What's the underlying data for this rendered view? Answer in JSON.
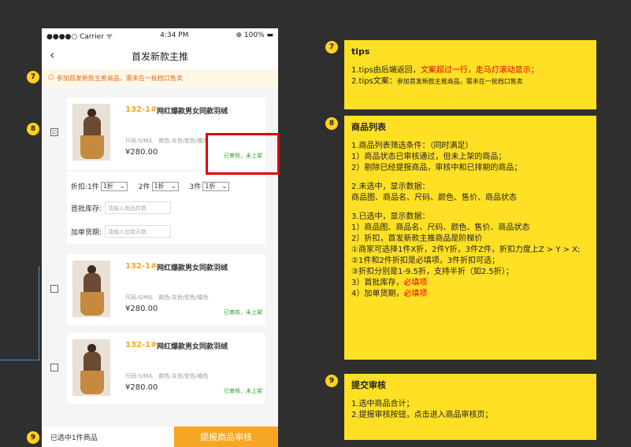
{
  "statusbar": {
    "carrier": "●●●●○ Carrier ᯤ",
    "time": "4:34 PM",
    "battery": "⊕ 100% ▬"
  },
  "nav": {
    "title": "首发新款主推",
    "back_icon": "chevron-left-icon"
  },
  "tips_bar": {
    "text": "参加首发新款主推商品，需未在一批档口售卖"
  },
  "products": [
    {
      "code": "132-1#",
      "name": "网红爆款男女同款羽绒",
      "attrs": "尺码:S/M/L　颜色:灰色/驼色/橘色",
      "price": "¥280.00",
      "state": "已审核，未上架",
      "checked": "☑"
    },
    {
      "code": "132-1#",
      "name": "网红爆款男女同款羽绒",
      "attrs": "尺码:S/M/L　颜色:灰色/驼色/橘色",
      "price": "¥280.00",
      "state": "已审核，未上架",
      "checked": ""
    },
    {
      "code": "132-1#",
      "name": "网红爆款男女同款羽绒",
      "attrs": "尺码:S/M/L　颜色:灰色/驼色/橘色",
      "price": "¥280.00",
      "state": "已审核，未上架",
      "checked": ""
    }
  ],
  "options": {
    "discount_label": "折扣:",
    "tier1": "1件",
    "tier2": "2件",
    "tier3": "3件",
    "select_value": "1折",
    "stock_label": "首批库存:",
    "stock_placeholder": "请输入商品件数",
    "days_label": "加单货期:",
    "days_placeholder": "请输入加单天数"
  },
  "footer": {
    "summary": "已选中1件商品",
    "submit": "提报商品审核"
  },
  "badges": {
    "b7": "7",
    "b8": "8",
    "b9": "9"
  },
  "notes": {
    "tips": {
      "badge": "7",
      "title": "tips",
      "l1a": "1.tips由后端返回，",
      "l1b": "文案超过一行，走马灯滚动显示；",
      "l2a": "2.tips文案：",
      "l2b": "参加首发新款主推商品，需未在一批档口售卖"
    },
    "list": {
      "badge": "8",
      "title": "商品列表",
      "l1": "1.商品列表筛选条件：（同时满足）",
      "l2": "1）商品状态已审核通过，但未上架的商品；",
      "l3": "2）剔除已经提报商品，审核中和已排期的商品；",
      "l4": "2.未选中，显示数据：",
      "l5": "商品图、商品名、尺码、颜色、售价、商品状态",
      "l6": "3.已选中，显示数据：",
      "l7": "1）商品图、商品名、尺码、颜色、售价、商品状态",
      "l8": "2）折扣，首发新款主推商品是阶梯价",
      "l9": "①商家可选择1件X折，2件Y折，3件Z件，折扣力度上Z > Y > X;",
      "l10": "②1件和2件折扣是必填项，3件折扣可选；",
      "l11": "③折扣分别是1-9.5折，支持半折（如2.5折）；",
      "l12a": "3）首批库存，",
      "l12b": "必填项",
      "l13a": "4）加单货期，",
      "l13b": "必填项"
    },
    "submit": {
      "badge": "9",
      "title": "提交审核",
      "l1": "1.选中商品合计；",
      "l2": "2.提报审核按钮，点击进入商品审核页；"
    }
  },
  "colors": {
    "accent": "#f5a623",
    "note_bg": "#ffe024",
    "highlight": "#e00000",
    "status_green": "#2aa52a"
  }
}
